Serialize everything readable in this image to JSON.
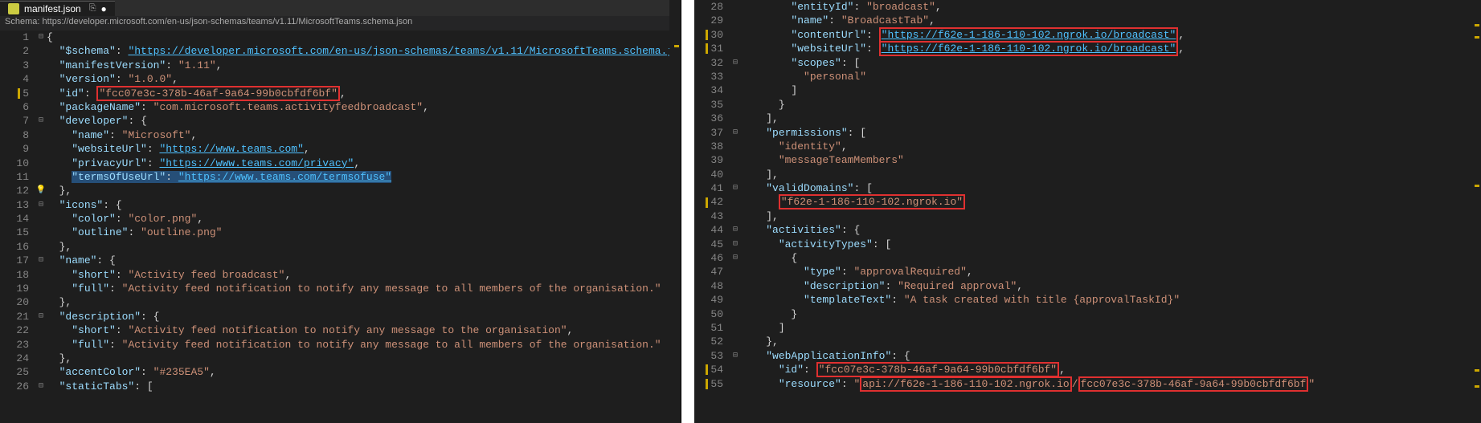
{
  "tab": {
    "filename": "manifest.json",
    "dirty_indicator": "●",
    "pin_icon": "⎘"
  },
  "schema": {
    "label": "Schema:",
    "url": "https://developer.microsoft.com/en-us/json-schemas/teams/v1.11/MicrosoftTeams.schema.json"
  },
  "left": {
    "start": 1,
    "lines": [
      "{",
      "  \"$schema\": \"https://developer.microsoft.com/en-us/json-schemas/teams/v1.11/MicrosoftTeams.schema.json\",",
      "  \"manifestVersion\": \"1.11\",",
      "  \"version\": \"1.0.0\",",
      "  \"id\": \"fcc07e3c-378b-46af-9a64-99b0cbfdf6bf\",",
      "  \"packageName\": \"com.microsoft.teams.activityfeedbroadcast\",",
      "  \"developer\": {",
      "    \"name\": \"Microsoft\",",
      "    \"websiteUrl\": \"https://www.teams.com\",",
      "    \"privacyUrl\": \"https://www.teams.com/privacy\",",
      "    \"termsOfUseUrl\": \"https://www.teams.com/termsofuse\"",
      "  },",
      "  \"icons\": {",
      "    \"color\": \"color.png\",",
      "    \"outline\": \"outline.png\"",
      "  },",
      "  \"name\": {",
      "    \"short\": \"Activity feed broadcast\",",
      "    \"full\": \"Activity feed notification to notify any message to all members of the organisation.\"",
      "  },",
      "  \"description\": {",
      "    \"short\": \"Activity feed notification to notify any message to the organisation\",",
      "    \"full\": \"Activity feed notification to notify any message to all members of the organisation.\"",
      "  },",
      "  \"accentColor\": \"#235EA5\",",
      "  \"staticTabs\": ["
    ],
    "schema_url_value": "https://developer.microsoft.com/en-us/json-schemas/teams/v1.11/MicrosoftTeams.schema.json",
    "id_value": "fcc07e3c-378b-46af-9a64-99b0cbfdf6bf",
    "websiteUrl_value": "https://www.teams.com",
    "privacyUrl_value": "https://www.teams.com/privacy",
    "termsUrl_value": "https://www.teams.com/termsofuse"
  },
  "right": {
    "start": 28,
    "lines": [
      "        \"entityId\": \"broadcast\",",
      "        \"name\": \"BroadcastTab\",",
      "        \"contentUrl\": \"https://f62e-1-186-110-102.ngrok.io/broadcast\",",
      "        \"websiteUrl\": \"https://f62e-1-186-110-102.ngrok.io/broadcast\",",
      "        \"scopes\": [",
      "          \"personal\"",
      "        ]",
      "      }",
      "    ],",
      "    \"permissions\": [",
      "      \"identity\",",
      "      \"messageTeamMembers\"",
      "    ],",
      "    \"validDomains\": [",
      "      \"f62e-1-186-110-102.ngrok.io\"",
      "    ],",
      "    \"activities\": {",
      "      \"activityTypes\": [",
      "        {",
      "          \"type\": \"approvalRequired\",",
      "          \"description\": \"Required approval\",",
      "          \"templateText\": \"A task created with title {approvalTaskId}\"",
      "        }",
      "      ]",
      "    },",
      "    \"webApplicationInfo\": {",
      "      \"id\": \"fcc07e3c-378b-46af-9a64-99b0cbfdf6bf\",",
      "      \"resource\": \"api://f62e-1-186-110-102.ngrok.io/fcc07e3c-378b-46af-9a64-99b0cbfdf6bf\""
    ],
    "contentUrl_value": "https://f62e-1-186-110-102.ngrok.io/broadcast",
    "websiteUrl_value": "https://f62e-1-186-110-102.ngrok.io/broadcast",
    "validDomain_value": "f62e-1-186-110-102.ngrok.io",
    "webAppId_value": "fcc07e3c-378b-46af-9a64-99b0cbfdf6bf",
    "resource_part1": "api://f62e-1-186-110-102.ngrok.io",
    "resource_part2": "fcc07e3c-378b-46af-9a64-99b0cbfdf6bf"
  }
}
